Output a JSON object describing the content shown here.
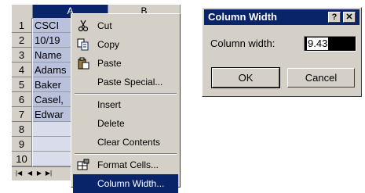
{
  "sheet": {
    "columns": [
      "A",
      "B"
    ],
    "rows": [
      "1",
      "2",
      "3",
      "4",
      "5",
      "6",
      "7",
      "8",
      "9",
      "10"
    ],
    "cells": [
      "CSCI",
      "10/19",
      "Name",
      "Adams",
      "Baker",
      "Casel,",
      "Edwar",
      "",
      "",
      ""
    ]
  },
  "context_menu": {
    "items": [
      {
        "label": "Cut",
        "icon": "scissors-icon"
      },
      {
        "label": "Copy",
        "icon": "copy-icon"
      },
      {
        "label": "Paste",
        "icon": "paste-icon"
      },
      {
        "label": "Paste Special...",
        "icon": ""
      },
      {
        "label": "Insert",
        "icon": ""
      },
      {
        "label": "Delete",
        "icon": ""
      },
      {
        "label": "Clear Contents",
        "icon": ""
      },
      {
        "label": "Format Cells...",
        "icon": "format-cells-icon"
      },
      {
        "label": "Column Width...",
        "icon": "",
        "highlighted": true
      }
    ]
  },
  "dialog": {
    "title": "Column Width",
    "help_glyph": "?",
    "close_glyph": "✕",
    "field_label": "Column width:",
    "field_value": "9.43",
    "ok_label": "OK",
    "cancel_label": "Cancel"
  },
  "colors": {
    "selection": "#0a246a",
    "face": "#d4d0c8",
    "cell_selected": "#b9c1dc"
  }
}
